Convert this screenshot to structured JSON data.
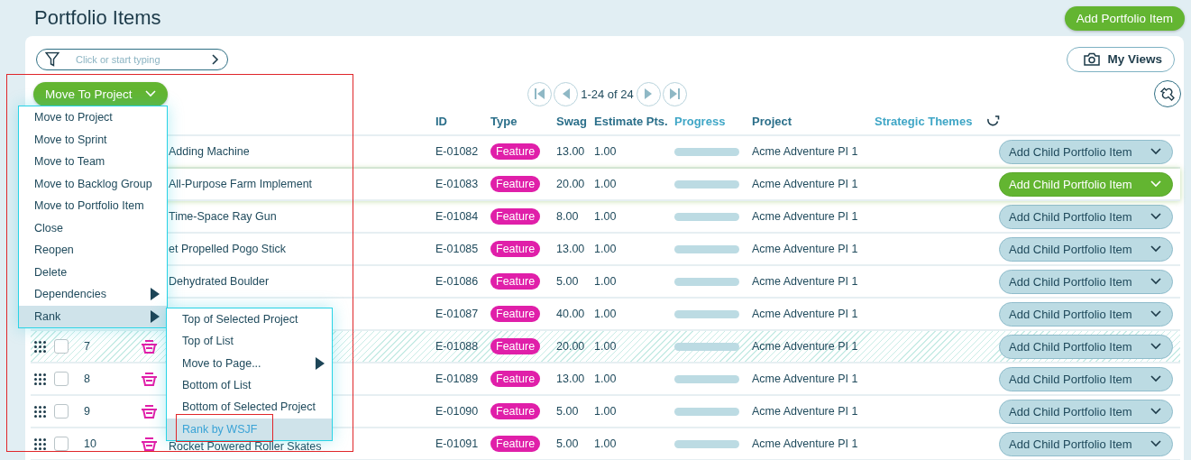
{
  "page": {
    "title": "Portfolio Items",
    "add_button": "Add Portfolio Item"
  },
  "filter": {
    "placeholder": "Click or start typing"
  },
  "my_views": "My Views",
  "bulk_action": "Move To Project",
  "pagination": {
    "range": "1-24 of 24"
  },
  "columns": [
    {
      "label": "ID",
      "color": "#2b6f8a"
    },
    {
      "label": "Type",
      "color": "#2b6f8a"
    },
    {
      "label": "Swag",
      "color": "#2b6f8a"
    },
    {
      "label": "Estimate Pts.",
      "color": "#2b6f8a"
    },
    {
      "label": "Progress",
      "color": "#3fa6c6"
    },
    {
      "label": "Project",
      "color": "#2b6f8a"
    },
    {
      "label": "Strategic Themes",
      "color": "#3fa6c6"
    }
  ],
  "rows": [
    {
      "name": "Adding Machine",
      "id": "E-01082",
      "type": "Feature",
      "swag": "13.00",
      "estimate": "1.00",
      "level": 0,
      "project": "Acme Adventure PI 1",
      "action": "Add Child Portfolio Item",
      "selected": false,
      "hatched": false
    },
    {
      "name": "All-Purpose Farm Implement",
      "id": "E-01083",
      "type": "Feature",
      "swag": "20.00",
      "estimate": "1.00",
      "level": 0,
      "project": "Acme Adventure PI 1",
      "action": "Add Child Portfolio Item",
      "selected": true,
      "hatched": false
    },
    {
      "name": "Time-Space Ray Gun",
      "id": "E-01084",
      "type": "Feature",
      "swag": "8.00",
      "estimate": "1.00",
      "level": 0,
      "project": "Acme Adventure PI 1",
      "action": "Add Child Portfolio Item",
      "selected": false,
      "hatched": false
    },
    {
      "name": "et Propelled Pogo Stick",
      "id": "E-01085",
      "type": "Feature",
      "swag": "13.00",
      "estimate": "1.00",
      "level": 0,
      "project": "Acme Adventure PI 1",
      "action": "Add Child Portfolio Item",
      "selected": false,
      "hatched": false
    },
    {
      "name": "Dehydrated Boulder",
      "id": "E-01086",
      "type": "Feature",
      "swag": "5.00",
      "estimate": "1.00",
      "level": 0,
      "project": "Acme Adventure PI 1",
      "action": "Add Child Portfolio Item",
      "selected": false,
      "hatched": false
    },
    {
      "id": "E-01087",
      "type": "Feature",
      "swag": "40.00",
      "estimate": "1.00",
      "level": 0,
      "project": "Acme Adventure PI 1",
      "action": "Add Child Portfolio Item",
      "selected": false,
      "hatched": false
    },
    {
      "number": "7",
      "checked": false,
      "id": "E-01088",
      "type": "Feature",
      "swag": "20.00",
      "estimate": "1.00",
      "level": 0,
      "project": "Acme Adventure PI 1",
      "action": "Add Child Portfolio Item",
      "selected": false,
      "hatched": true
    },
    {
      "number": "8",
      "checked": false,
      "id": "E-01089",
      "type": "Feature",
      "swag": "13.00",
      "estimate": "1.00",
      "level": 0,
      "project": "Acme Adventure PI 1",
      "action": "Add Child Portfolio Item",
      "selected": false,
      "hatched": false
    },
    {
      "number": "9",
      "checked": false,
      "id": "E-01090",
      "type": "Feature",
      "swag": "5.00",
      "estimate": "1.00",
      "level": 0,
      "project": "Acme Adventure PI 1",
      "action": "Add Child Portfolio Item",
      "selected": false,
      "hatched": false
    },
    {
      "number": "10",
      "checked": false,
      "name": "Rocket Powered Roller Skates",
      "id": "E-01091",
      "type": "Feature",
      "swag": "5.00",
      "estimate": "1.00",
      "level": 0,
      "project": "Acme Adventure PI 1",
      "action": "Add Child Portfolio Item",
      "selected": false,
      "hatched": false
    }
  ],
  "menu": {
    "items": [
      {
        "label": "Move to Project",
        "selected": false,
        "submenu": false
      },
      {
        "label": "Move to Sprint",
        "selected": false,
        "submenu": false
      },
      {
        "label": "Move to Team",
        "selected": false,
        "submenu": false
      },
      {
        "label": "Move to Backlog Group",
        "selected": false,
        "submenu": false
      },
      {
        "label": "Move to Portfolio Item",
        "selected": false,
        "submenu": false
      },
      {
        "label": "Close",
        "selected": false,
        "submenu": false
      },
      {
        "label": "Reopen",
        "selected": false,
        "submenu": false
      },
      {
        "label": "Delete",
        "selected": false,
        "submenu": false
      },
      {
        "label": "Dependencies",
        "selected": false,
        "submenu": true
      },
      {
        "label": "Rank",
        "selected": true,
        "submenu": true
      }
    ]
  },
  "submenu": {
    "items": [
      {
        "label": "Top of Selected Project",
        "selected": false,
        "submenu": false
      },
      {
        "label": "Top of List",
        "selected": false,
        "submenu": false
      },
      {
        "label": "Move to Page...",
        "selected": false,
        "submenu": true
      },
      {
        "label": "Bottom of List",
        "selected": false,
        "submenu": false
      },
      {
        "label": "Bottom of Selected Project",
        "selected": false,
        "submenu": false
      },
      {
        "label": "Rank by WSJF",
        "selected": true,
        "submenu": false
      }
    ]
  }
}
